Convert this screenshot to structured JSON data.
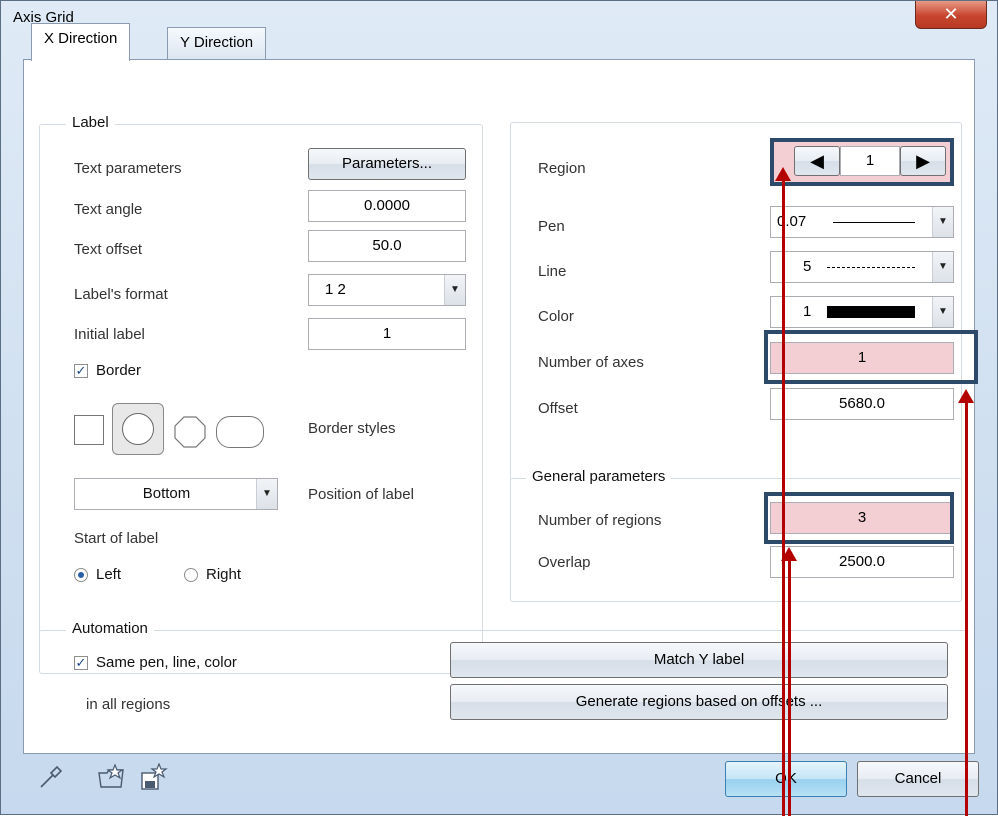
{
  "window": {
    "title": "Axis Grid",
    "close_glyph": "✕"
  },
  "tabs": [
    {
      "label": "X Direction"
    },
    {
      "label": "Y Direction"
    }
  ],
  "label_group": {
    "title": "Label",
    "text_parameters": {
      "label": "Text parameters",
      "button": "Parameters..."
    },
    "text_angle": {
      "label": "Text angle",
      "value": "0.0000"
    },
    "text_offset": {
      "label": "Text offset",
      "value": "50.0"
    },
    "labels_format": {
      "label": "Label's format",
      "value": "1  2"
    },
    "initial_label": {
      "label": "Initial label",
      "value": "1"
    },
    "border": {
      "label": "Border",
      "checked": true
    },
    "border_styles": {
      "label": "Border styles"
    },
    "position": {
      "value": "Bottom",
      "label": "Position of label"
    },
    "start_of_label": {
      "label": "Start of label",
      "left": "Left",
      "right": "Right",
      "selected": "Left"
    }
  },
  "region_group": {
    "region": {
      "label": "Region",
      "value": "1"
    },
    "pen": {
      "label": "Pen",
      "value": "0.07"
    },
    "line": {
      "label": "Line",
      "value": "5"
    },
    "color": {
      "label": "Color",
      "value": "1"
    },
    "number_of_axes": {
      "label": "Number of axes",
      "value": "1"
    },
    "offset": {
      "label": "Offset",
      "value": "5680.0"
    }
  },
  "general": {
    "title": "General parameters",
    "number_of_regions": {
      "label": "Number of regions",
      "value": "3"
    },
    "overlap": {
      "label": "Overlap",
      "value": "2500.0"
    }
  },
  "automation": {
    "title": "Automation",
    "same_pen": {
      "label": "Same pen, line, color",
      "checked": true
    },
    "in_all_regions": "in all regions",
    "match_y": "Match Y label",
    "generate": "Generate regions based on offsets ..."
  },
  "footer": {
    "ok": "OK",
    "cancel": "Cancel"
  },
  "colors": {
    "highlight": "#f3cfd4",
    "annotation_red": "#b30000",
    "focus_border": "#2e4a6a"
  },
  "icons": [
    "eyedropper-icon",
    "favorites-folder-icon",
    "save-favorite-icon"
  ]
}
